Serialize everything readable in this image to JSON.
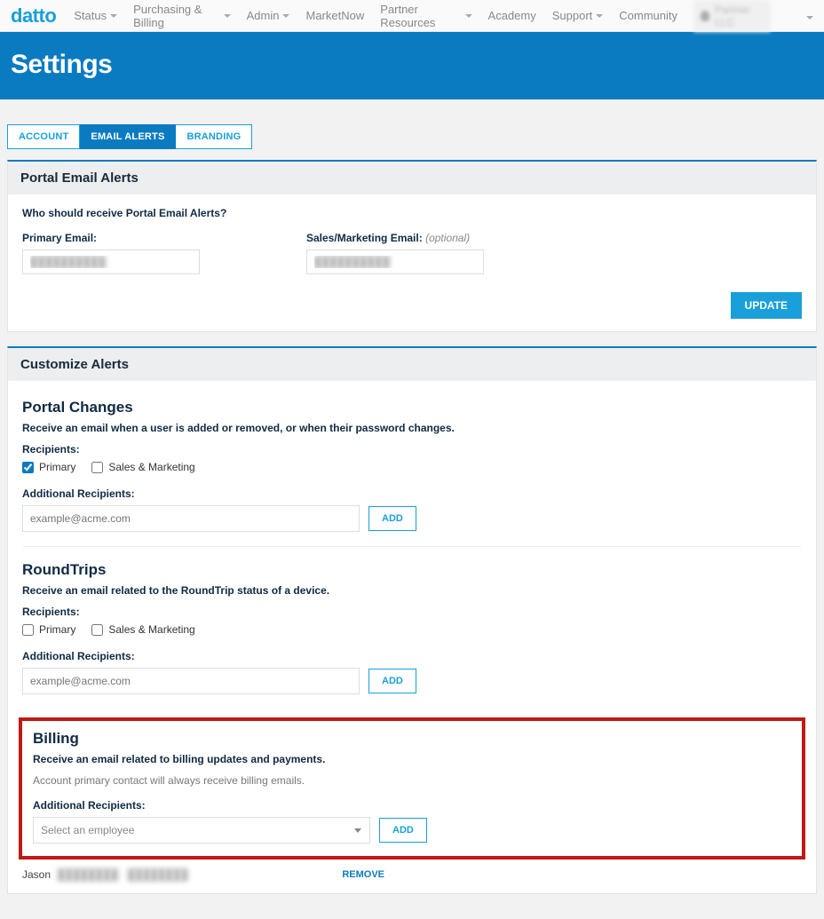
{
  "brand": "datto",
  "nav": {
    "items": [
      {
        "label": "Status",
        "caret": true
      },
      {
        "label": "Purchasing & Billing",
        "caret": true
      },
      {
        "label": "Admin",
        "caret": true
      },
      {
        "label": "MarketNow",
        "caret": false
      },
      {
        "label": "Partner Resources",
        "caret": true
      },
      {
        "label": "Academy",
        "caret": false
      },
      {
        "label": "Support",
        "caret": true
      },
      {
        "label": "Community",
        "caret": false
      }
    ],
    "user_label": "Partner LLC"
  },
  "banner": {
    "title": "Settings"
  },
  "tabs": [
    {
      "label": "ACCOUNT",
      "active": false
    },
    {
      "label": "EMAIL ALERTS",
      "active": true
    },
    {
      "label": "BRANDING",
      "active": false
    }
  ],
  "portal_alerts": {
    "panel_title": "Portal Email Alerts",
    "question": "Who should receive Portal Email Alerts?",
    "primary_label": "Primary Email:",
    "primary_value": "██████████",
    "sales_label": "Sales/Marketing Email:",
    "sales_optional": "(optional)",
    "sales_value": "██████████",
    "update_btn": "UPDATE"
  },
  "customize": {
    "panel_title": "Customize Alerts",
    "recipients_label": "Recipients:",
    "primary_check": "Primary",
    "sales_check": "Sales & Marketing",
    "additional_label": "Additional Recipients:",
    "placeholder_email": "example@acme.com",
    "add_btn": "ADD",
    "portal_changes": {
      "title": "Portal Changes",
      "desc": "Receive an email when a user is added or removed, or when their password changes.",
      "primary_checked": true,
      "sales_checked": false
    },
    "roundtrips": {
      "title": "RoundTrips",
      "desc": "Receive an email related to the RoundTrip status of a device.",
      "primary_checked": false,
      "sales_checked": false
    },
    "billing": {
      "title": "Billing",
      "desc": "Receive an email related to billing updates and payments.",
      "note": "Account primary contact will always receive billing emails.",
      "select_placeholder": "Select an employee",
      "entry_name": "Jason",
      "entry_mask": "████████ · ████████",
      "remove_label": "REMOVE"
    }
  }
}
